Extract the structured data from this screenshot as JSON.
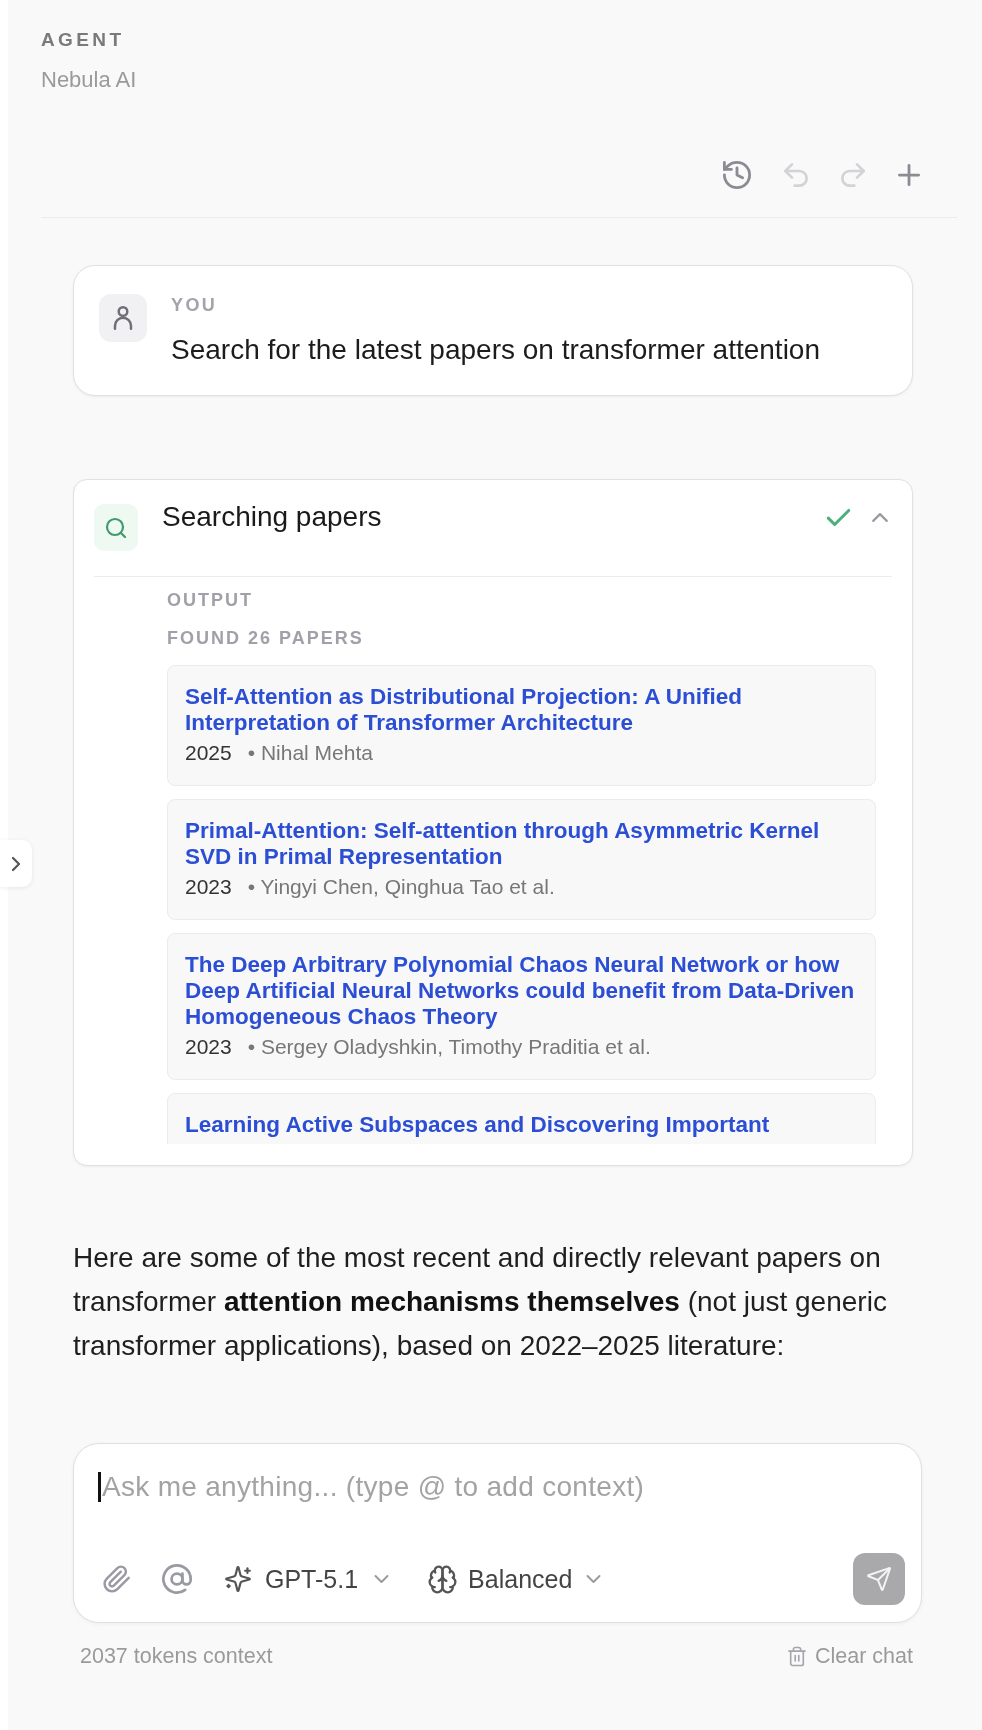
{
  "agent": {
    "label": "AGENT",
    "name": "Nebula AI"
  },
  "toolbar": [
    {
      "kind": "history",
      "disabled": false
    },
    {
      "kind": "undo",
      "disabled": true
    },
    {
      "kind": "redo",
      "disabled": true
    },
    {
      "kind": "new_chat",
      "disabled": false
    }
  ],
  "messages": [
    {
      "kind": "user",
      "author": "YOU",
      "text": "Search for the latest papers on transformer attention"
    },
    {
      "kind": "tool",
      "title": "Searching papers",
      "done": true,
      "expanded": true,
      "output_label": "OUTPUT",
      "result_label": "FOUND 26 PAPERS",
      "papers": [
        {
          "title": "Self-Attention as Distributional Projection: A Unified Interpretation of Transformer Architecture",
          "year": "2025",
          "authors": "• Nihal Mehta"
        },
        {
          "title": "Primal-Attention: Self-attention through Asymmetric Kernel SVD in Primal Representation",
          "year": "2023",
          "authors": "• Yingyi Chen, Qinghua Tao et al."
        },
        {
          "title": "The Deep Arbitrary Polynomial Chaos Neural Network or how Deep Artificial Neural Networks could benefit from Data-Driven Homogeneous Chaos Theory",
          "year": "2023",
          "authors": "• Sergey Oladyshkin, Timothy Praditia et al."
        },
        {
          "title": "Learning Active Subspaces and Discovering Important"
        }
      ]
    },
    {
      "kind": "assistant",
      "text": "Here are some of the most recent and directly relevant papers on transformer **attention mechanisms themselves** (not just generic transformer applications), based on 2022–2025 literature:"
    }
  ],
  "composer": {
    "placeholder": "Ask me anything... (type @ to add context)",
    "focused": true,
    "model": "GPT-5.1",
    "mode": "Balanced",
    "send": {
      "disabled": true
    }
  },
  "footer": {
    "context": "2037 tokens context",
    "clear_button": "Clear chat"
  },
  "sidebar_toggle": {
    "expanded": false
  }
}
